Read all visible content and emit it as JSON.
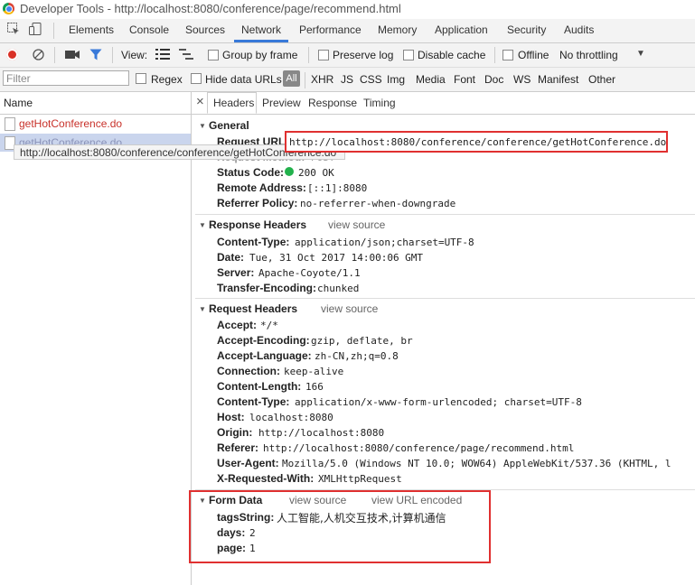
{
  "window": {
    "title": "Developer Tools - http://localhost:8080/conference/page/recommend.html"
  },
  "tabs": [
    "Elements",
    "Console",
    "Sources",
    "Network",
    "Performance",
    "Memory",
    "Application",
    "Security",
    "Audits"
  ],
  "toolbar": {
    "view_label": "View:",
    "group_by_frame": "Group by frame",
    "preserve_log": "Preserve log",
    "disable_cache": "Disable cache",
    "offline": "Offline",
    "throttling": "No throttling"
  },
  "filter": {
    "placeholder": "Filter",
    "regex": "Regex",
    "hide_data_urls": "Hide data URLs",
    "types": [
      "All",
      "XHR",
      "JS",
      "CSS",
      "Img",
      "Media",
      "Font",
      "Doc",
      "WS",
      "Manifest",
      "Other"
    ]
  },
  "requests": {
    "header": "Name",
    "items": [
      "getHotConference.do",
      "getHotConference.do"
    ],
    "tooltip": "http://localhost:8080/conference/conference/getHotConference.do"
  },
  "detail": {
    "close": "×",
    "tabs": [
      "Headers",
      "Preview",
      "Response",
      "Timing"
    ],
    "general": {
      "title": "General",
      "request_url_key": "Request URL:",
      "request_url": "http://localhost:8080/conference/conference/getHotConference.do",
      "request_method_key": "Request Method:",
      "request_method": "POST",
      "status_key": "Status Code:",
      "status": "200 OK",
      "remote_key": "Remote Address:",
      "remote": "[::1]:8080",
      "referrer_key": "Referrer Policy:",
      "referrer": "no-referrer-when-downgrade"
    },
    "response_headers": {
      "title": "Response Headers",
      "view_source": "view source",
      "rows": [
        {
          "k": "Content-Type:",
          "v": "application/json;charset=UTF-8"
        },
        {
          "k": "Date:",
          "v": "Tue, 31 Oct 2017 14:00:06 GMT"
        },
        {
          "k": "Server:",
          "v": "Apache-Coyote/1.1"
        },
        {
          "k": "Transfer-Encoding:",
          "v": "chunked"
        }
      ]
    },
    "request_headers": {
      "title": "Request Headers",
      "view_source": "view source",
      "rows": [
        {
          "k": "Accept:",
          "v": "*/*"
        },
        {
          "k": "Accept-Encoding:",
          "v": "gzip, deflate, br"
        },
        {
          "k": "Accept-Language:",
          "v": "zh-CN,zh;q=0.8"
        },
        {
          "k": "Connection:",
          "v": "keep-alive"
        },
        {
          "k": "Content-Length:",
          "v": "166"
        },
        {
          "k": "Content-Type:",
          "v": "application/x-www-form-urlencoded; charset=UTF-8"
        },
        {
          "k": "Host:",
          "v": "localhost:8080"
        },
        {
          "k": "Origin:",
          "v": "http://localhost:8080"
        },
        {
          "k": "Referer:",
          "v": "http://localhost:8080/conference/page/recommend.html"
        },
        {
          "k": "User-Agent:",
          "v": "Mozilla/5.0 (Windows NT 10.0; WOW64) AppleWebKit/537.36 (KHTML, l"
        },
        {
          "k": "X-Requested-With:",
          "v": "XMLHttpRequest"
        }
      ]
    },
    "form_data": {
      "title": "Form Data",
      "view_source": "view source",
      "view_url_encoded": "view URL encoded",
      "rows": [
        {
          "k": "tagsString:",
          "v": "人工智能,人机交互技术,计算机通信"
        },
        {
          "k": "days:",
          "v": "2"
        },
        {
          "k": "page:",
          "v": "1"
        }
      ]
    }
  },
  "colors": {
    "accent": "#3879d9",
    "record": "#d93025",
    "highlight_box": "#e03030",
    "status_ok": "#22b14c"
  }
}
